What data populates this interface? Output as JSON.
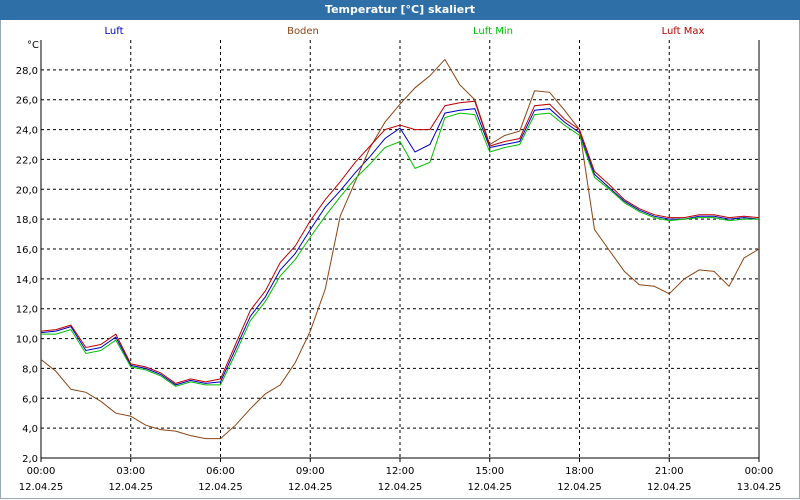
{
  "window": {
    "title": "Temperatur [°C] skaliert"
  },
  "chart_data": {
    "type": "line",
    "title": "Temperatur [°C] skaliert",
    "ylabel": "°C",
    "ylim": [
      2,
      30
    ],
    "yticks": [
      "2,0",
      "4,0",
      "6,0",
      "8,0",
      "10,0",
      "12,0",
      "14,0",
      "16,0",
      "18,0",
      "20,0",
      "22,0",
      "24,0",
      "26,0",
      "28,0"
    ],
    "xlim": [
      0,
      24
    ],
    "xticks": [
      {
        "time": "00:00",
        "date": "12.04.25"
      },
      {
        "time": "03:00",
        "date": "12.04.25"
      },
      {
        "time": "06:00",
        "date": "12.04.25"
      },
      {
        "time": "09:00",
        "date": "12.04.25"
      },
      {
        "time": "12:00",
        "date": "12.04.25"
      },
      {
        "time": "15:00",
        "date": "12.04.25"
      },
      {
        "time": "18:00",
        "date": "12.04.25"
      },
      {
        "time": "21:00",
        "date": "12.04.25"
      },
      {
        "time": "00:00",
        "date": "13.04.25"
      }
    ],
    "grid": true,
    "legend_position": "top",
    "series": [
      {
        "name": "Luft",
        "color": "#0000c0",
        "x": [
          0,
          0.5,
          1.0,
          1.5,
          2.0,
          2.5,
          3.0,
          3.5,
          4.0,
          4.5,
          5.0,
          5.5,
          6.0,
          6.5,
          7.0,
          7.5,
          8.0,
          8.5,
          9.0,
          9.5,
          10.0,
          10.5,
          11.0,
          11.5,
          12.0,
          12.5,
          13.0,
          13.5,
          14.0,
          14.5,
          15.0,
          15.5,
          16.0,
          16.5,
          17.0,
          17.5,
          18.0,
          18.5,
          19.0,
          19.5,
          20.0,
          20.5,
          21.0,
          21.5,
          22.0,
          22.5,
          23.0,
          23.5,
          24.0
        ],
        "y": [
          10.4,
          10.5,
          10.8,
          9.2,
          9.4,
          10.1,
          8.2,
          8.0,
          7.6,
          6.9,
          7.2,
          7.0,
          7.1,
          9.3,
          11.5,
          12.8,
          14.6,
          15.7,
          17.3,
          18.8,
          19.9,
          21.1,
          22.2,
          23.4,
          24.1,
          22.5,
          23.0,
          25.1,
          25.3,
          25.4,
          22.8,
          23.0,
          23.2,
          25.3,
          25.4,
          24.5,
          23.8,
          21.0,
          20.1,
          19.2,
          18.6,
          18.2,
          18.0,
          18.0,
          18.2,
          18.2,
          18.0,
          18.1,
          18.0
        ]
      },
      {
        "name": "Boden",
        "color": "#8b4513",
        "x": [
          0,
          0.5,
          1.0,
          1.5,
          2.0,
          2.5,
          3.0,
          3.5,
          4.0,
          4.5,
          5.0,
          5.5,
          6.0,
          6.5,
          7.0,
          7.5,
          8.0,
          8.5,
          9.0,
          9.5,
          10.0,
          10.5,
          11.0,
          11.5,
          12.0,
          12.5,
          13.0,
          13.5,
          14.0,
          14.5,
          15.0,
          15.5,
          16.0,
          16.5,
          17.0,
          17.5,
          18.0,
          18.5,
          19.0,
          19.5,
          20.0,
          20.5,
          21.0,
          21.5,
          22.0,
          22.5,
          23.0,
          23.5,
          24.0
        ],
        "y": [
          8.6,
          7.8,
          6.6,
          6.4,
          5.8,
          5.0,
          4.8,
          4.2,
          3.9,
          3.8,
          3.5,
          3.3,
          3.3,
          4.2,
          5.3,
          6.3,
          6.9,
          8.4,
          10.5,
          13.3,
          18.2,
          20.5,
          22.8,
          24.5,
          25.7,
          26.8,
          27.6,
          28.7,
          27.0,
          26.0,
          23.0,
          23.6,
          23.9,
          26.6,
          26.5,
          25.3,
          24.0,
          17.3,
          15.9,
          14.5,
          13.6,
          13.5,
          13.0,
          14.0,
          14.6,
          14.5,
          13.5,
          15.4,
          16.0
        ]
      },
      {
        "name": "Luft Min",
        "color": "#00c000",
        "x": [
          0,
          0.5,
          1.0,
          1.5,
          2.0,
          2.5,
          3.0,
          3.5,
          4.0,
          4.5,
          5.0,
          5.5,
          6.0,
          6.5,
          7.0,
          7.5,
          8.0,
          8.5,
          9.0,
          9.5,
          10.0,
          10.5,
          11.0,
          11.5,
          12.0,
          12.5,
          13.0,
          13.5,
          14.0,
          14.5,
          15.0,
          15.5,
          16.0,
          16.5,
          17.0,
          17.5,
          18.0,
          18.5,
          19.0,
          19.5,
          20.0,
          20.5,
          21.0,
          21.5,
          22.0,
          22.5,
          23.0,
          23.5,
          24.0
        ],
        "y": [
          10.3,
          10.3,
          10.6,
          9.0,
          9.2,
          9.9,
          8.1,
          7.9,
          7.5,
          6.8,
          7.1,
          6.9,
          6.9,
          9.0,
          11.2,
          12.5,
          14.2,
          15.3,
          16.8,
          18.2,
          19.5,
          20.7,
          21.7,
          22.8,
          23.2,
          21.4,
          21.8,
          24.8,
          25.1,
          25.0,
          22.5,
          22.8,
          23.0,
          25.0,
          25.1,
          24.3,
          23.6,
          20.8,
          20.0,
          19.1,
          18.5,
          18.1,
          17.9,
          18.0,
          18.1,
          18.1,
          17.9,
          18.0,
          18.0
        ]
      },
      {
        "name": "Luft Max",
        "color": "#c00000",
        "x": [
          0,
          0.5,
          1.0,
          1.5,
          2.0,
          2.5,
          3.0,
          3.5,
          4.0,
          4.5,
          5.0,
          5.5,
          6.0,
          6.5,
          7.0,
          7.5,
          8.0,
          8.5,
          9.0,
          9.5,
          10.0,
          10.5,
          11.0,
          11.5,
          12.0,
          12.5,
          13.0,
          13.5,
          14.0,
          14.5,
          15.0,
          15.5,
          16.0,
          16.5,
          17.0,
          17.5,
          18.0,
          18.5,
          19.0,
          19.5,
          20.0,
          20.5,
          21.0,
          21.5,
          22.0,
          22.5,
          23.0,
          23.5,
          24.0
        ],
        "y": [
          10.5,
          10.6,
          10.9,
          9.4,
          9.6,
          10.3,
          8.3,
          8.1,
          7.7,
          7.0,
          7.3,
          7.1,
          7.3,
          9.6,
          11.9,
          13.2,
          15.1,
          16.2,
          17.9,
          19.3,
          20.5,
          21.8,
          22.9,
          24.0,
          24.3,
          24.0,
          24.0,
          25.6,
          25.8,
          25.9,
          22.9,
          23.2,
          23.4,
          25.6,
          25.7,
          24.7,
          24.0,
          21.2,
          20.3,
          19.3,
          18.7,
          18.3,
          18.1,
          18.1,
          18.3,
          18.3,
          18.1,
          18.2,
          18.1
        ]
      }
    ]
  }
}
